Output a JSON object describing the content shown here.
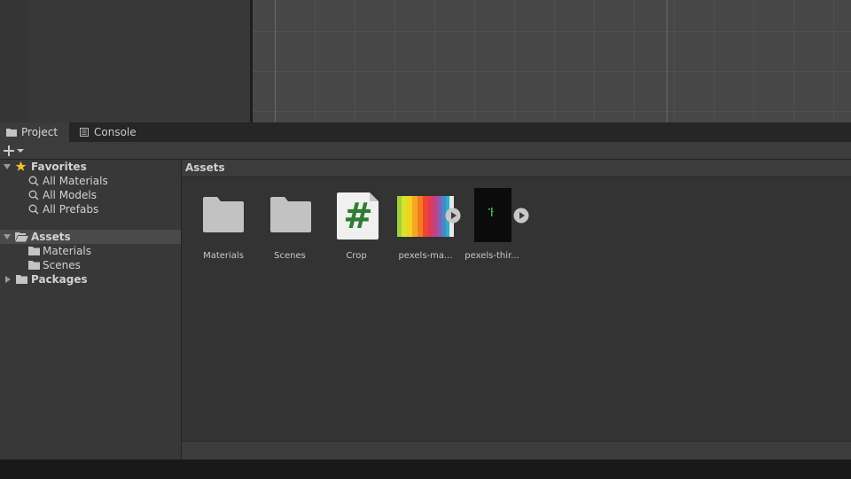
{
  "tabs": [
    {
      "label": "Project",
      "icon": "folder-icon",
      "active": true
    },
    {
      "label": "Console",
      "icon": "console-icon",
      "active": false
    }
  ],
  "toolbar": {
    "add_icon": "plus-icon",
    "dropdown_icon": "caret-down-icon"
  },
  "tree": {
    "favorites": {
      "label": "Favorites",
      "icon": "star-icon",
      "items": [
        "All Materials",
        "All Models",
        "All Prefabs"
      ]
    },
    "assets": {
      "label": "Assets",
      "icon": "open-folder-icon",
      "items": [
        "Materials",
        "Scenes"
      ]
    },
    "packages": {
      "label": "Packages",
      "icon": "folder-icon"
    }
  },
  "asset_panel": {
    "header": "Assets",
    "items": [
      {
        "label": "Materials",
        "kind": "folder"
      },
      {
        "label": "Scenes",
        "kind": "folder"
      },
      {
        "label": "Crop",
        "kind": "script",
        "glyph": "#"
      },
      {
        "label": "pexels-ma...",
        "kind": "video"
      },
      {
        "label": "pexels-thir...",
        "kind": "video"
      }
    ]
  },
  "colors": {
    "background": "#383838",
    "scene": "#474747",
    "selection": "#4a4a4a",
    "star": "#f0c030",
    "script_hash": "#2e7d32"
  }
}
